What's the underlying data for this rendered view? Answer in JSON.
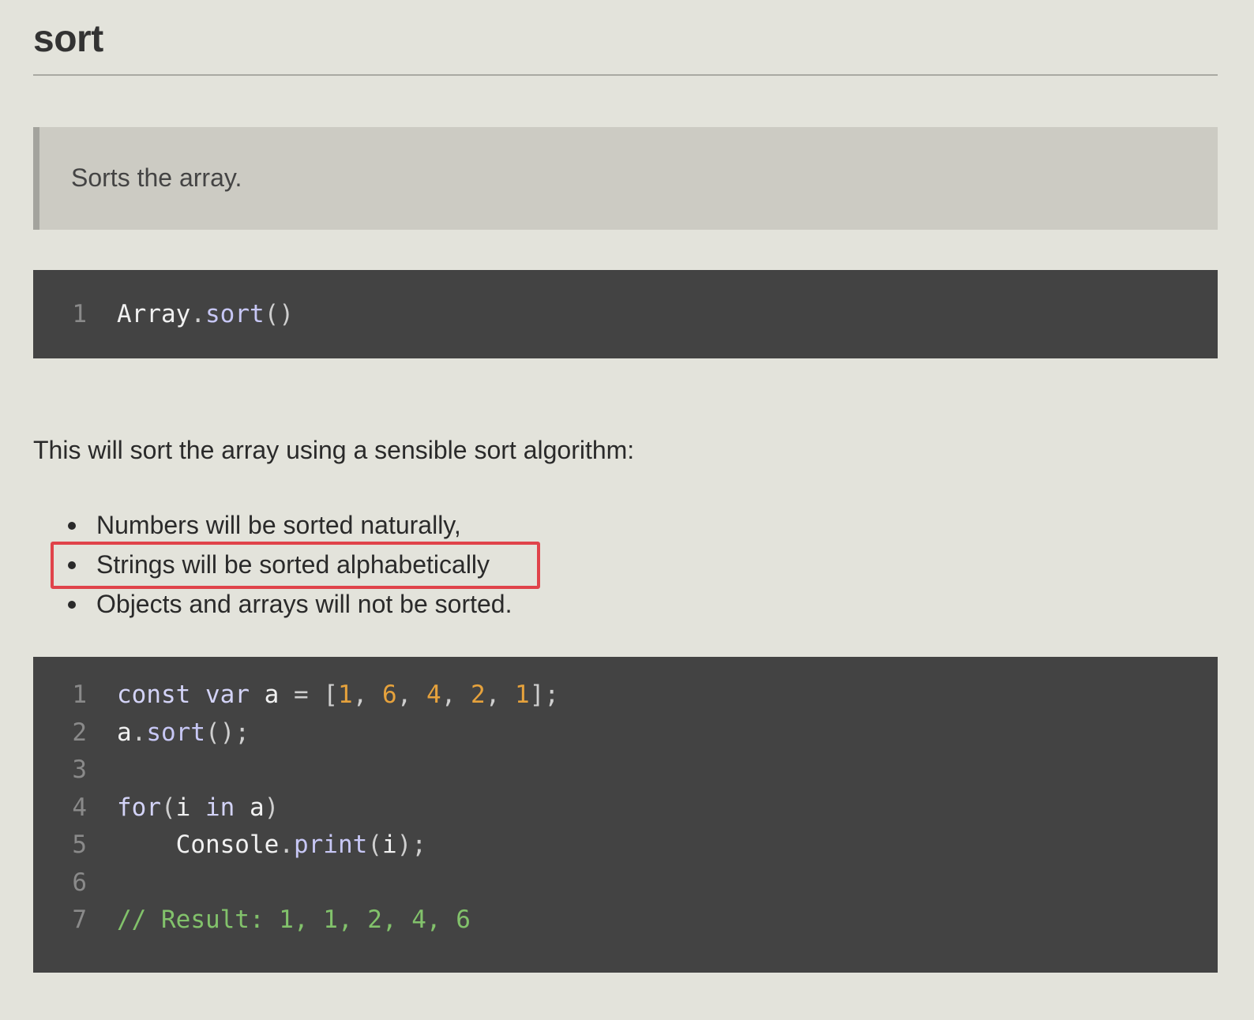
{
  "page": {
    "title": "sort"
  },
  "summary": {
    "text": "Sorts the array."
  },
  "signature": {
    "lines": [
      {
        "number": "1",
        "tokens": [
          {
            "text": "Array",
            "kind": "plain"
          },
          {
            "text": ".",
            "kind": "punct"
          },
          {
            "text": "sort",
            "kind": "method"
          },
          {
            "text": "()",
            "kind": "punct"
          }
        ]
      }
    ]
  },
  "description": {
    "intro": "This will sort the array using a sensible sort algorithm:",
    "bullets": [
      "Numbers will be sorted naturally,",
      "Strings will be sorted alphabetically",
      "Objects and arrays will not be sorted."
    ],
    "highlighted_bullet_index": 1,
    "highlight_color": "#e0434a"
  },
  "example": {
    "lines": [
      {
        "number": "1",
        "tokens": [
          {
            "text": "const",
            "kind": "keyword"
          },
          {
            "text": " ",
            "kind": "plain"
          },
          {
            "text": "var",
            "kind": "keyword"
          },
          {
            "text": " a ",
            "kind": "plain"
          },
          {
            "text": "=",
            "kind": "punct"
          },
          {
            "text": " ",
            "kind": "plain"
          },
          {
            "text": "[",
            "kind": "punct"
          },
          {
            "text": "1",
            "kind": "number"
          },
          {
            "text": ", ",
            "kind": "punct"
          },
          {
            "text": "6",
            "kind": "number"
          },
          {
            "text": ", ",
            "kind": "punct"
          },
          {
            "text": "4",
            "kind": "number"
          },
          {
            "text": ", ",
            "kind": "punct"
          },
          {
            "text": "2",
            "kind": "number"
          },
          {
            "text": ", ",
            "kind": "punct"
          },
          {
            "text": "1",
            "kind": "number"
          },
          {
            "text": "];",
            "kind": "punct"
          }
        ]
      },
      {
        "number": "2",
        "tokens": [
          {
            "text": "a",
            "kind": "plain"
          },
          {
            "text": ".",
            "kind": "punct"
          },
          {
            "text": "sort",
            "kind": "method"
          },
          {
            "text": "();",
            "kind": "punct"
          }
        ]
      },
      {
        "number": "3",
        "tokens": []
      },
      {
        "number": "4",
        "tokens": [
          {
            "text": "for",
            "kind": "keyword"
          },
          {
            "text": "(",
            "kind": "punct"
          },
          {
            "text": "i ",
            "kind": "plain"
          },
          {
            "text": "in",
            "kind": "keyword"
          },
          {
            "text": " a",
            "kind": "plain"
          },
          {
            "text": ")",
            "kind": "punct"
          }
        ]
      },
      {
        "number": "5",
        "tokens": [
          {
            "text": "    Console",
            "kind": "plain"
          },
          {
            "text": ".",
            "kind": "punct"
          },
          {
            "text": "print",
            "kind": "method"
          },
          {
            "text": "(",
            "kind": "punct"
          },
          {
            "text": "i",
            "kind": "plain"
          },
          {
            "text": ");",
            "kind": "punct"
          }
        ]
      },
      {
        "number": "6",
        "tokens": []
      },
      {
        "number": "7",
        "tokens": [
          {
            "text": "// Result: 1, 1, 2, 4, 6",
            "kind": "comment"
          }
        ]
      }
    ]
  },
  "colors": {
    "page_background": "#e3e3db",
    "blockquote_background": "#cccbc3",
    "code_background": "#434343",
    "number": "#e6a23c",
    "comment": "#82c26b",
    "keyword": "#d3d3f7"
  }
}
